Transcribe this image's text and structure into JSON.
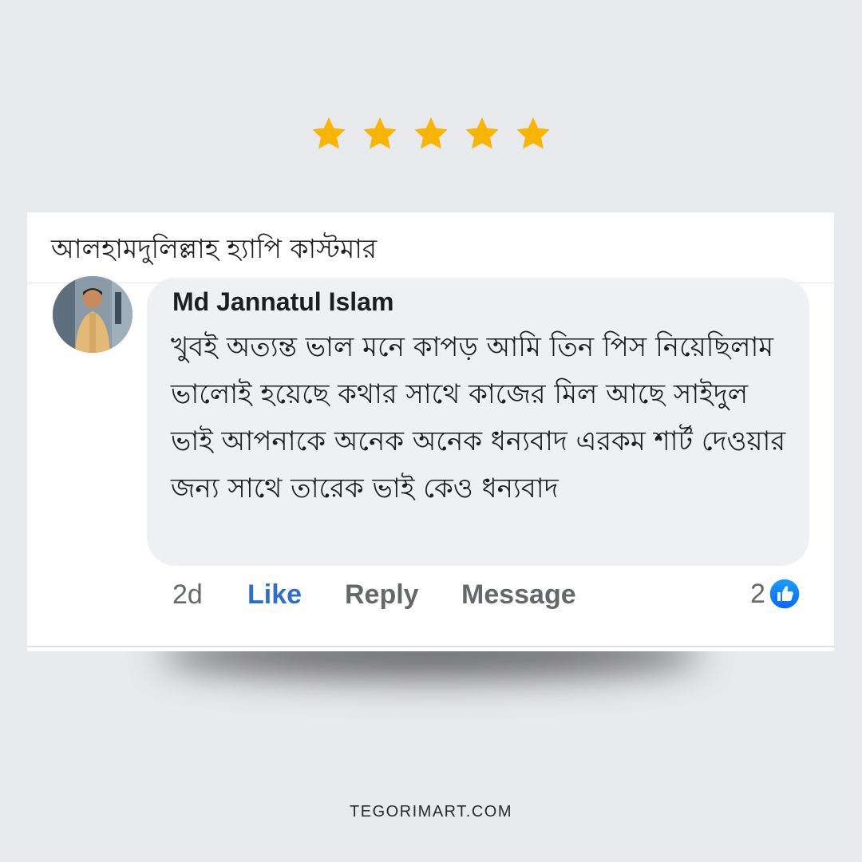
{
  "rating": {
    "stars": 5,
    "max": 5,
    "color": "#f7b500"
  },
  "post": {
    "title": "আলহামদুলিল্লাহ হ্যাপি কাস্টমার"
  },
  "comment": {
    "author": "Md Jannatul Islam",
    "text": "খুবই অত্যন্ত ভাল মনে কাপড় আমি তিন পিস নিয়েছিলাম ভালোই হয়েছে কথার সাথে কাজের মিল আছে সাইদুল ভাই আপনাকে অনেক অনেক ধন্যবাদ এরকম শার্ট দেওয়ার জন্য সাথে তারেক ভাই কেও ধন্যবাদ",
    "time": "2d",
    "like_label": "Like",
    "reply_label": "Reply",
    "message_label": "Message",
    "reaction_count": "2",
    "like_color": "#2f6fc9",
    "reaction_icon": "thumbs-up-icon"
  },
  "footer": {
    "brand": "TEGORIMART.COM"
  }
}
